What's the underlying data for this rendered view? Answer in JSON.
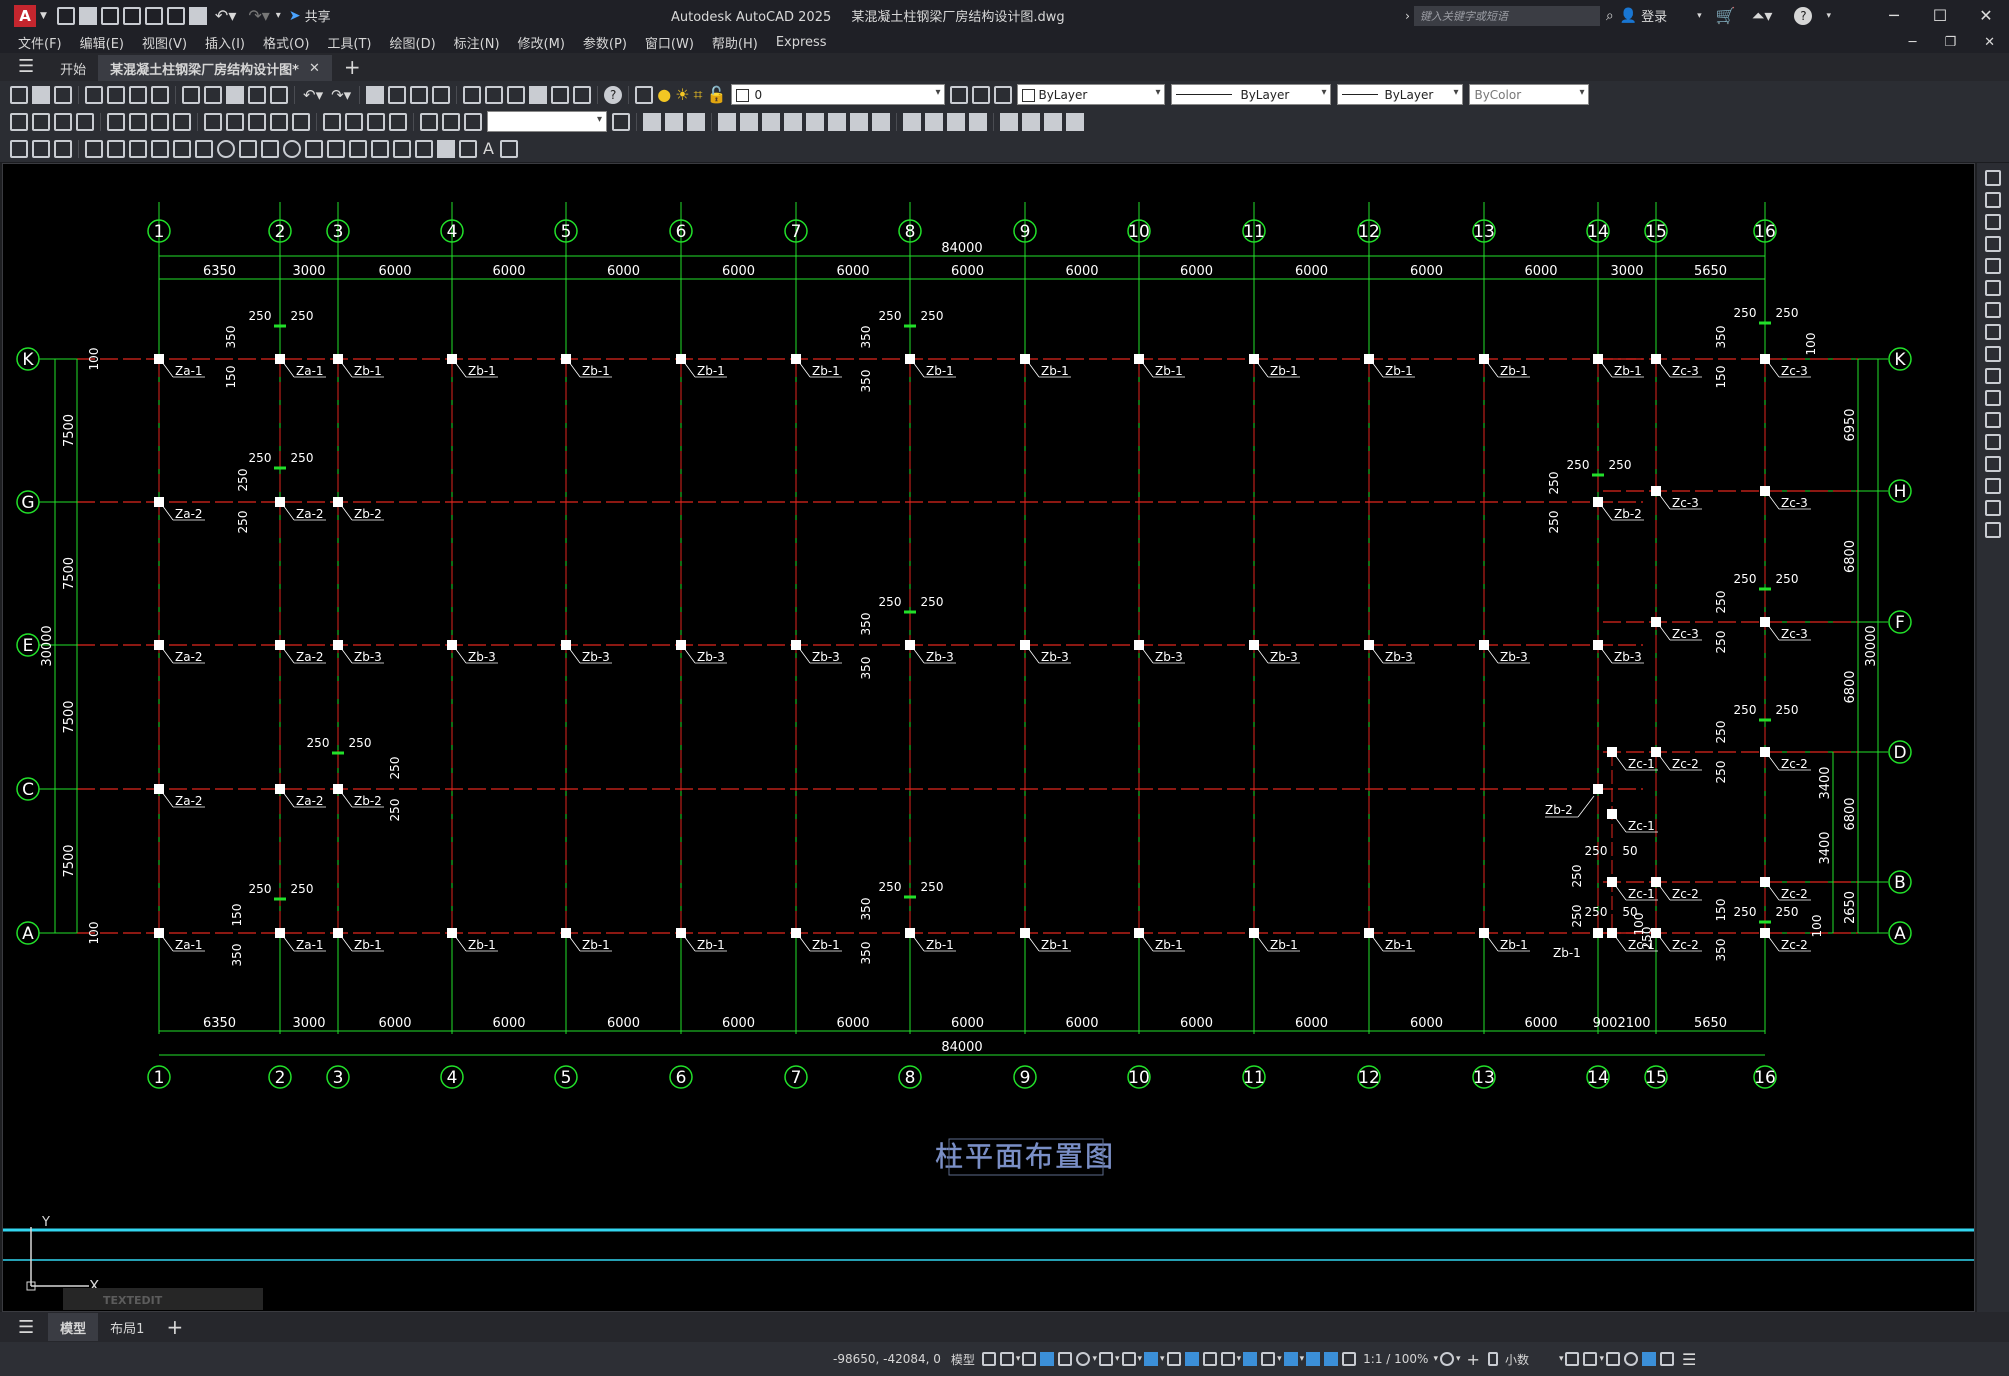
{
  "app": {
    "logo": "A",
    "title": "Autodesk AutoCAD 2025",
    "file": "某混凝土柱钢梁厂房结构设计图.dwg",
    "share": "共享",
    "search_placeholder": "键入关键字或短语",
    "login": "登录"
  },
  "menu": [
    "文件(F)",
    "编辑(E)",
    "视图(V)",
    "插入(I)",
    "格式(O)",
    "工具(T)",
    "绘图(D)",
    "标注(N)",
    "修改(M)",
    "参数(P)",
    "窗口(W)",
    "帮助(H)",
    "Express"
  ],
  "tabs": {
    "start": "开始",
    "doc": "某混凝土柱钢梁厂房结构设计图*"
  },
  "properties": {
    "layer": "0",
    "color": "ByLayer",
    "linetype": "ByLayer",
    "lineweight": "ByLayer",
    "plotstyle": "ByColor"
  },
  "drawing": {
    "title": "柱平面布置图",
    "total_x": "84000",
    "total_y": "30000",
    "col_axes": [
      "1",
      "2",
      "3",
      "4",
      "5",
      "6",
      "7",
      "8",
      "9",
      "10",
      "11",
      "12",
      "13",
      "14",
      "15",
      "16"
    ],
    "row_axes_left": [
      "K",
      "G",
      "E",
      "C",
      "A"
    ],
    "row_axes_right": [
      "K",
      "H",
      "F",
      "D",
      "B",
      "A"
    ],
    "top_dims": [
      "6350",
      "3000",
      "6000",
      "6000",
      "6000",
      "6000",
      "6000",
      "6000",
      "6000",
      "6000",
      "6000",
      "6000",
      "6000",
      "3000",
      "5650"
    ],
    "bottom_dims": [
      "6350",
      "3000",
      "6000",
      "6000",
      "6000",
      "6000",
      "6000",
      "6000",
      "6000",
      "6000",
      "6000",
      "6000",
      "6000",
      "900",
      "2100",
      "5650"
    ],
    "left_dims": [
      "7500",
      "7500",
      "7500",
      "7500"
    ],
    "right_dims": [
      "6950",
      "6800",
      "6800",
      "3400",
      "3400",
      "2650"
    ],
    "right_dims_outer": [
      "6800",
      "30000"
    ],
    "labels": {
      "za1": "Za-1",
      "za2": "Za-2",
      "zb1": "Zb-1",
      "zb2": "Zb-2",
      "zb3": "Zb-3",
      "zc1": "Zc-1",
      "zc2": "Zc-2",
      "zc3": "Zc-3"
    },
    "small_dims": {
      "a": "250",
      "b": "350",
      "c": "150",
      "d": "100",
      "e": "50"
    }
  },
  "command": {
    "text": "TEXTEDIT",
    "ucs_x": "X",
    "ucs_y": "Y"
  },
  "layout_tabs": [
    "模型",
    "布局1"
  ],
  "status": {
    "coords": "-98650, -42084, 0",
    "model": "模型",
    "scale": "1:1 / 100%",
    "units": "小数"
  }
}
